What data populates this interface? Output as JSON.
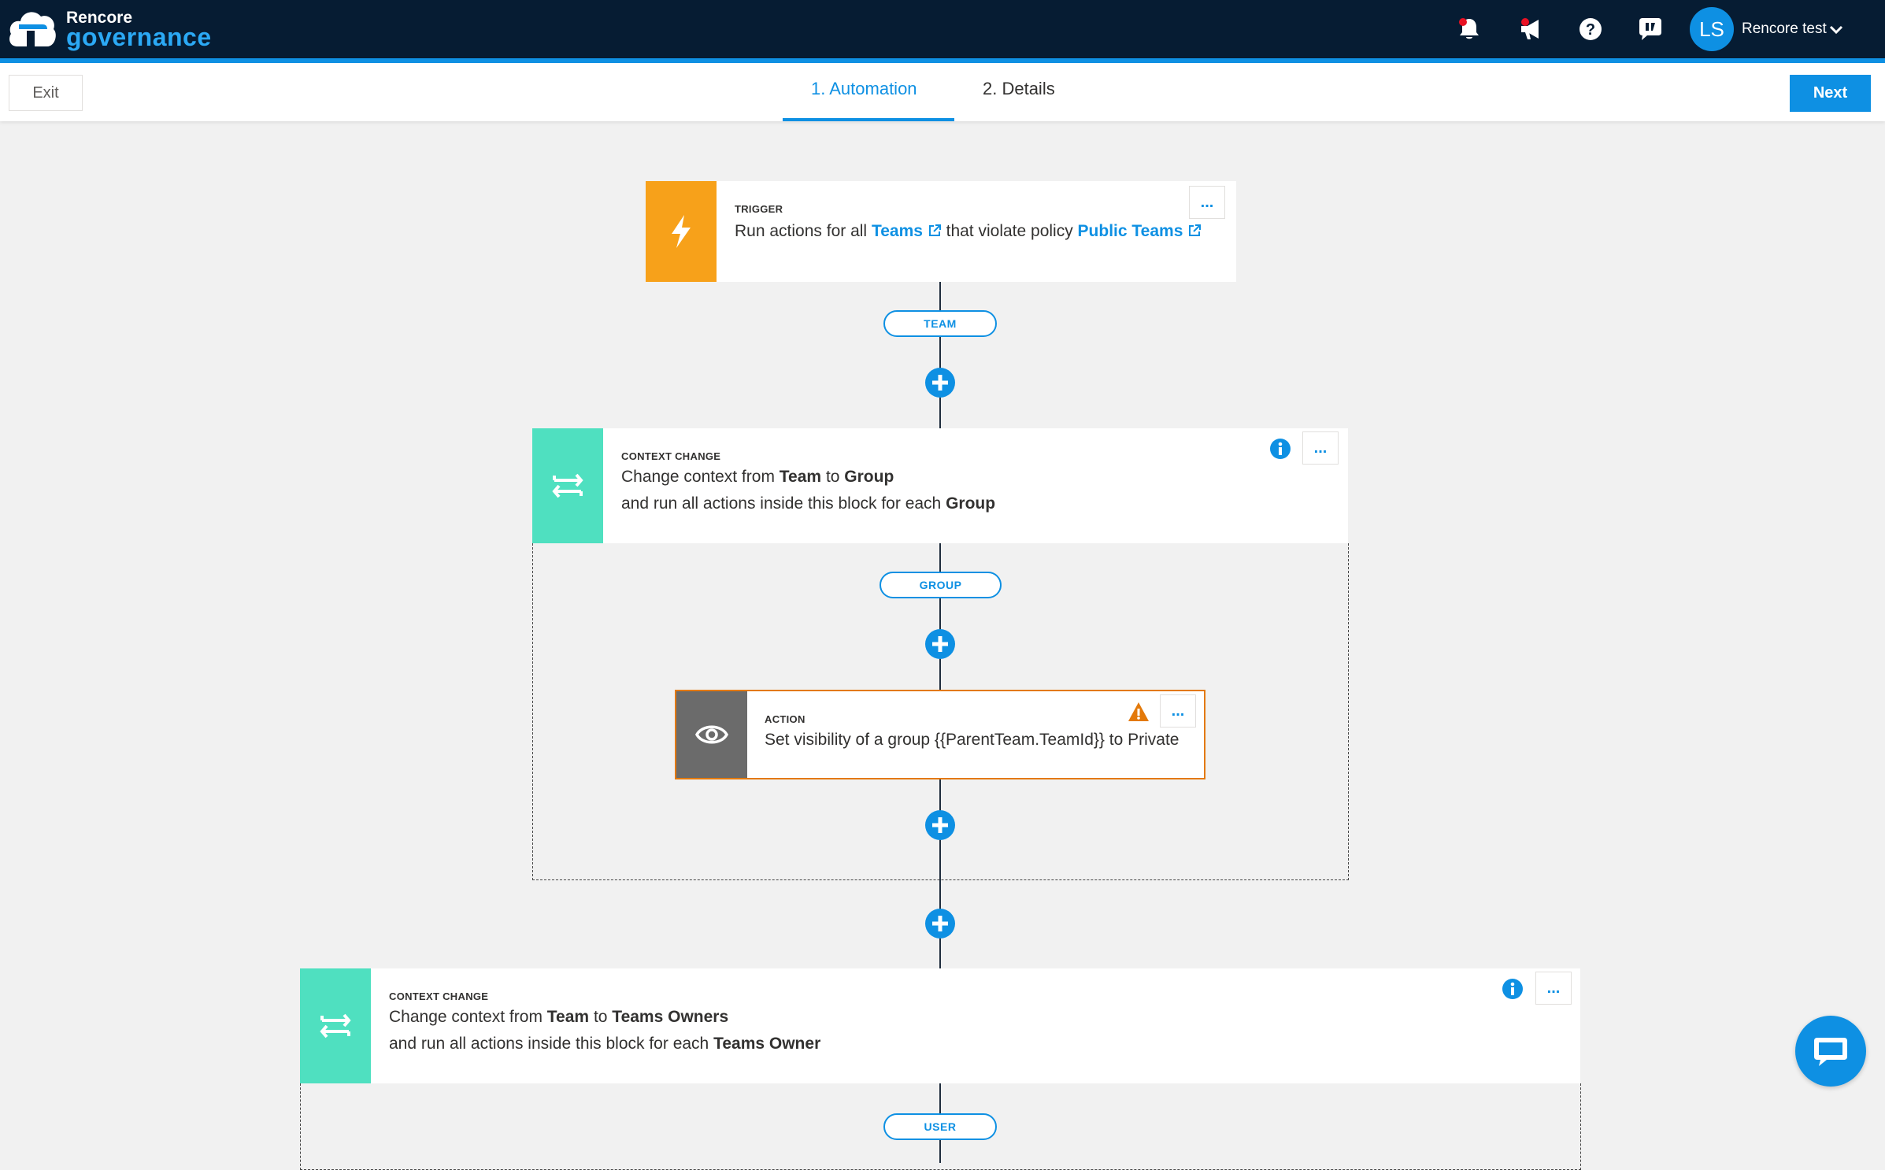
{
  "app": {
    "brand_line1": "Rencore",
    "brand_line2": "governance",
    "user_initials": "LS",
    "user_name": "Rencore test"
  },
  "toolbar": {
    "exit_label": "Exit",
    "tabs": [
      {
        "label": "1. Automation",
        "active": true
      },
      {
        "label": "2. Details",
        "active": false
      }
    ],
    "next_label": "Next"
  },
  "colors": {
    "nav_bg": "#061c33",
    "accent": "#0e90e3",
    "trigger": "#f7a11a",
    "context_change": "#4fe0c0",
    "action": "#6b6b6b",
    "warning": "#e3790a"
  },
  "icons": {
    "notifications": "bell-icon",
    "announcements": "megaphone-icon",
    "help": "question-icon",
    "feedback": "feedback-icon",
    "user_menu": "chevron-down-icon",
    "chat": "chat-icon"
  },
  "flow": {
    "trigger": {
      "label": "TRIGGER",
      "text_prefix": "Run actions for all",
      "object_link": "Teams",
      "text_middle": "that violate policy",
      "policy_link": "Public Teams",
      "output_pill": "TEAM"
    },
    "context1": {
      "label": "CONTEXT CHANGE",
      "line1_prefix": "Change context from",
      "from": "Team",
      "line1_to": "to",
      "to": "Group",
      "line2_prefix": "and run all actions inside this block for each",
      "each": "Group",
      "inner_pill": "GROUP"
    },
    "action1": {
      "label": "ACTION",
      "text": "Set visibility of a group {{ParentTeam.TeamId}} to Private"
    },
    "context2": {
      "label": "CONTEXT CHANGE",
      "line1_prefix": "Change context from",
      "from": "Team",
      "line1_to": "to",
      "to": "Teams Owners",
      "line2_prefix": "and run all actions inside this block for each",
      "each": "Teams Owner",
      "inner_pill": "USER"
    },
    "menu_label": "..."
  }
}
